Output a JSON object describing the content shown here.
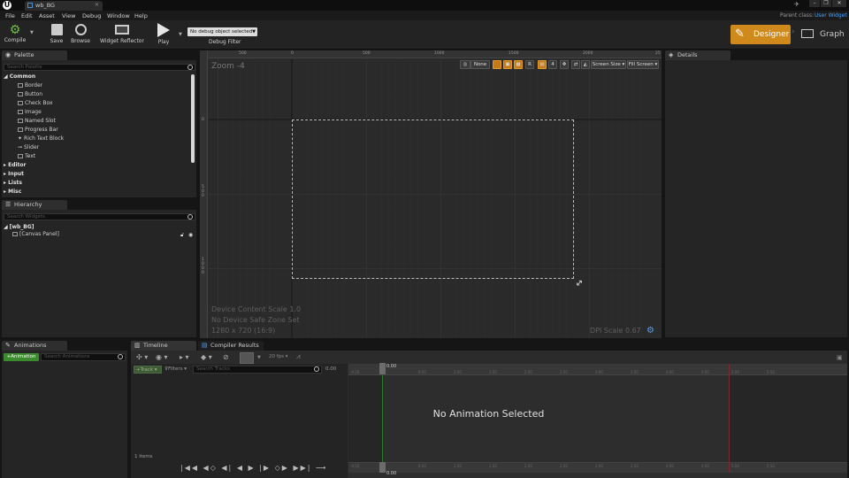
{
  "window": {
    "tab_title": "wb_BG",
    "parent_class_label": "Parent class:",
    "parent_class_value": "User Widget"
  },
  "menu": [
    "File",
    "Edit",
    "Asset",
    "View",
    "Debug",
    "Window",
    "Help"
  ],
  "toolbar": {
    "compile": "Compile",
    "save": "Save",
    "browse": "Browse",
    "widget_reflector": "Widget Reflector",
    "play": "Play",
    "debug_select": "No debug object selected",
    "debug_filter": "Debug Filter",
    "designer": "Designer",
    "graph": "Graph"
  },
  "palette": {
    "tab": "Palette",
    "search_placeholder": "Search Palette",
    "common": "Common",
    "items": [
      "Border",
      "Button",
      "Check Box",
      "Image",
      "Named Slot",
      "Progress Bar",
      "Rich Text Block",
      "Slider",
      "Text"
    ],
    "categories": [
      "Editor",
      "Input",
      "Lists",
      "Misc"
    ]
  },
  "hierarchy": {
    "tab": "Hierarchy",
    "search_placeholder": "Search Widgets",
    "root": "[wb_BG]",
    "child": "[Canvas Panel]"
  },
  "viewport": {
    "zoom": "Zoom -4",
    "none_label": "None",
    "r_label": "R",
    "four_label": "4",
    "screen_size": "Screen Size",
    "fill_screen": "Fill Screen",
    "ruler_top": [
      "500",
      "0",
      "500",
      "1000",
      "1500",
      "2000",
      "25"
    ],
    "ruler_left": [
      "0",
      "5\n0\n0",
      "1\n0\n0\n0"
    ],
    "info_line1": "Device Content Scale 1.0",
    "info_line2": "No Device Safe Zone Set",
    "info_line3": "1280 x 720 (16:9)",
    "dpi_scale": "DPI Scale 0.67"
  },
  "details": {
    "tab": "Details"
  },
  "animations": {
    "tab": "Animations",
    "add_button": "+Animation",
    "search_placeholder": "Search Animations"
  },
  "timeline": {
    "tab": "Timeline",
    "compiler_tab": "Compiler Results",
    "fps": "20 fps",
    "track": "+Track",
    "filters": "Filters",
    "search_tracks": "Search Tracks",
    "time_value": "0.00",
    "playhead_top": "0.00",
    "playhead_bottom": "0.00",
    "ticks": [
      "-0.50",
      "0.00",
      "0.50",
      "1.00",
      "1.50",
      "2.00",
      "2.50",
      "3.00",
      "3.50",
      "4.00",
      "4.50",
      "5.00",
      "5.50"
    ],
    "items_count": "1 items",
    "empty_message": "No Animation Selected"
  },
  "colors": {
    "accent_orange": "#d08a1c",
    "parent_class_blue": "#4aa3ff",
    "add_green": "#3c8a2e"
  }
}
